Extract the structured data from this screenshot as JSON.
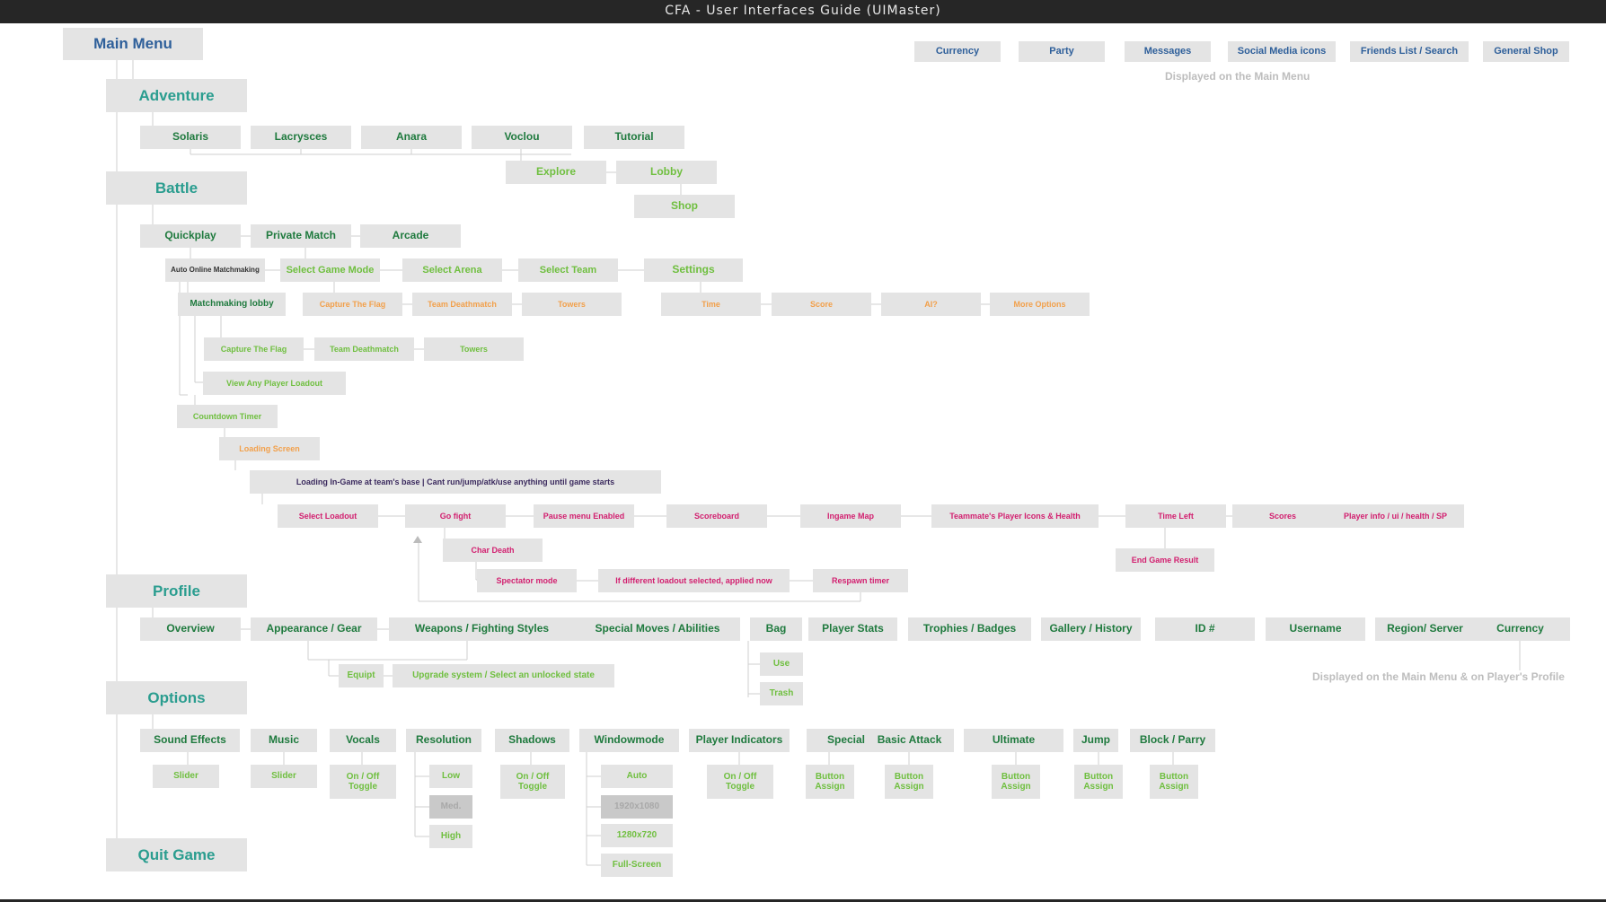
{
  "title": "CFA - User Interfaces Guide (UIMaster)",
  "colors": {
    "blue": "#2e5f9a",
    "teal": "#2a9d8f",
    "darkgreen": "#1f7a3e",
    "lightgreen": "#6fbf3f",
    "orange": "#f2a04b",
    "magenta": "#d21f6f",
    "purple": "#3b2a5e",
    "black": "#333333",
    "grey": "#a8a8a8",
    "box": "#e4e4e4",
    "wire": "#cfcfcf"
  },
  "notes": {
    "main_menu": "Displayed on the Main Menu",
    "profile": "Displayed on the Main Menu & on Player's Profile"
  },
  "labels": {
    "main_menu": "Main Menu",
    "top_currency": "Currency",
    "top_party": "Party",
    "top_messages": "Messages",
    "top_social": "Social Media icons",
    "top_friends": "Friends List / Search",
    "top_shop": "General Shop",
    "adventure": "Adventure",
    "adv_solaris": "Solaris",
    "adv_lacrysces": "Lacrysces",
    "adv_anara": "Anara",
    "adv_voclou": "Voclou",
    "adv_tutorial": "Tutorial",
    "adv_explore": "Explore",
    "adv_lobby": "Lobby",
    "adv_shop": "Shop",
    "battle": "Battle",
    "b_quickplay": "Quickplay",
    "b_private": "Private Match",
    "b_arcade": "Arcade",
    "b_auto": "Auto Online Matchmaking",
    "b_gamemode": "Select Game Mode",
    "b_arena": "Select Arena",
    "b_team": "Select Team",
    "b_settings": "Settings",
    "b_mlobby": "Matchmaking lobby",
    "b_ctf_o": "Capture The Flag",
    "b_tdm_o": "Team Deathmatch",
    "b_towers_o": "Towers",
    "b_time": "Time",
    "b_score": "Score",
    "b_ai": "AI?",
    "b_more": "More Options",
    "b_ctf": "Capture The Flag",
    "b_tdm": "Team Deathmatch",
    "b_towers": "Towers",
    "b_loadout_view": "View Any Player Loadout",
    "b_countdown": "Countdown Timer",
    "b_loading": "Loading Screen",
    "b_ingame": "Loading In-Game at team's base | Cant run/jump/atk/use anything until game starts",
    "g_loadout": "Select Loadout",
    "g_gofight": "Go fight",
    "g_pause": "Pause menu Enabled",
    "g_scoreboard": "Scoreboard",
    "g_map": "Ingame Map",
    "g_mates": "Teammate's Player Icons & Health",
    "g_timeleft": "Time Left",
    "g_scores": "Scores",
    "g_playerinfo": "Player info / ui / health / SP",
    "g_chardeath": "Char Death",
    "g_endgame": "End Game Result",
    "g_spectator": "Spectator mode",
    "g_diffload": "If different loadout selected, applied now",
    "g_respawn": "Respawn timer",
    "profile": "Profile",
    "p_overview": "Overview",
    "p_appearance": "Appearance / Gear",
    "p_weapons": "Weapons / Fighting Styles",
    "p_special": "Special Moves / Abilities",
    "p_bag": "Bag",
    "p_stats": "Player Stats",
    "p_trophies": "Trophies / Badges",
    "p_gallery": "Gallery / History",
    "p_id": "ID #",
    "p_username": "Username",
    "p_region": "Region/ Server",
    "p_currency": "Currency",
    "p_equipt": "Equipt",
    "p_upgrade": "Upgrade system / Select an unlocked state",
    "p_use": "Use",
    "p_trash": "Trash",
    "options": "Options",
    "o_sfx": "Sound Effects",
    "o_music": "Music",
    "o_vocals": "Vocals",
    "o_resolution": "Resolution",
    "o_shadows": "Shadows",
    "o_windowmode": "Windowmode",
    "o_indicators": "Player Indicators",
    "o_special": "Special",
    "o_basic": "Basic Attack",
    "o_ultimate": "Ultimate",
    "o_jump": "Jump",
    "o_block": "Block / Parry",
    "o_sfx_slider": "Slider",
    "o_music_slider": "Slider",
    "o_vocals_toggle": "On / Off Toggle",
    "o_low": "Low",
    "o_med": "Med.",
    "o_high": "High",
    "o_shadows_toggle": "On / Off Toggle",
    "o_auto": "Auto",
    "o_1920": "1920x1080",
    "o_1280": "1280x720",
    "o_full": "Full-Screen",
    "o_ind_toggle": "On / Off Toggle",
    "o_special_btn": "Button Assign",
    "o_basic_btn": "Button Assign",
    "o_ultimate_btn": "Button Assign",
    "o_jump_btn": "Button Assign",
    "o_block_btn": "Button Assign",
    "quit": "Quit Game"
  },
  "node_colors": {
    "main_menu": "blue",
    "top_currency": "blue",
    "top_party": "blue",
    "top_messages": "blue",
    "top_social": "blue",
    "top_friends": "blue",
    "top_shop": "blue",
    "adventure": "teal",
    "battle": "teal",
    "profile": "teal",
    "options": "teal",
    "quit": "teal",
    "adv_solaris": "darkgreen",
    "adv_lacrysces": "darkgreen",
    "adv_anara": "darkgreen",
    "adv_voclou": "darkgreen",
    "adv_tutorial": "darkgreen",
    "adv_explore": "lightgreen",
    "adv_lobby": "lightgreen",
    "adv_shop": "lightgreen",
    "b_quickplay": "darkgreen",
    "b_private": "darkgreen",
    "b_arcade": "darkgreen",
    "b_auto": "black",
    "b_gamemode": "lightgreen",
    "b_arena": "lightgreen",
    "b_team": "lightgreen",
    "b_settings": "lightgreen",
    "b_mlobby": "darkgreen",
    "b_ctf_o": "orange",
    "b_tdm_o": "orange",
    "b_towers_o": "orange",
    "b_time": "orange",
    "b_score": "orange",
    "b_ai": "orange",
    "b_more": "orange",
    "b_ctf": "lightgreen",
    "b_tdm": "lightgreen",
    "b_towers": "lightgreen",
    "b_loadout_view": "lightgreen",
    "b_countdown": "lightgreen",
    "b_loading": "orange",
    "b_ingame": "purple",
    "g_loadout": "magenta",
    "g_gofight": "magenta",
    "g_pause": "magenta",
    "g_scoreboard": "magenta",
    "g_map": "magenta",
    "g_mates": "magenta",
    "g_timeleft": "magenta",
    "g_scores": "magenta",
    "g_playerinfo": "magenta",
    "g_chardeath": "magenta",
    "g_endgame": "magenta",
    "g_spectator": "magenta",
    "g_diffload": "magenta",
    "g_respawn": "magenta",
    "p_overview": "darkgreen",
    "p_appearance": "darkgreen",
    "p_weapons": "darkgreen",
    "p_special": "darkgreen",
    "p_bag": "darkgreen",
    "p_stats": "darkgreen",
    "p_trophies": "darkgreen",
    "p_gallery": "darkgreen",
    "p_id": "darkgreen",
    "p_username": "darkgreen",
    "p_region": "darkgreen",
    "p_currency": "darkgreen",
    "p_equipt": "lightgreen",
    "p_upgrade": "lightgreen",
    "p_use": "lightgreen",
    "p_trash": "lightgreen",
    "o_sfx": "darkgreen",
    "o_music": "darkgreen",
    "o_vocals": "darkgreen",
    "o_resolution": "darkgreen",
    "o_shadows": "darkgreen",
    "o_windowmode": "darkgreen",
    "o_indicators": "darkgreen",
    "o_special": "darkgreen",
    "o_basic": "darkgreen",
    "o_ultimate": "darkgreen",
    "o_jump": "darkgreen",
    "o_block": "darkgreen",
    "o_sfx_slider": "lightgreen",
    "o_music_slider": "lightgreen",
    "o_vocals_toggle": "lightgreen",
    "o_low": "lightgreen",
    "o_med": "grey",
    "o_high": "lightgreen",
    "o_shadows_toggle": "lightgreen",
    "o_auto": "lightgreen",
    "o_1920": "grey",
    "o_1280": "lightgreen",
    "o_full": "lightgreen",
    "o_ind_toggle": "lightgreen",
    "o_special_btn": "lightgreen",
    "o_basic_btn": "lightgreen",
    "o_ultimate_btn": "lightgreen",
    "o_jump_btn": "lightgreen",
    "o_block_btn": "lightgreen"
  }
}
